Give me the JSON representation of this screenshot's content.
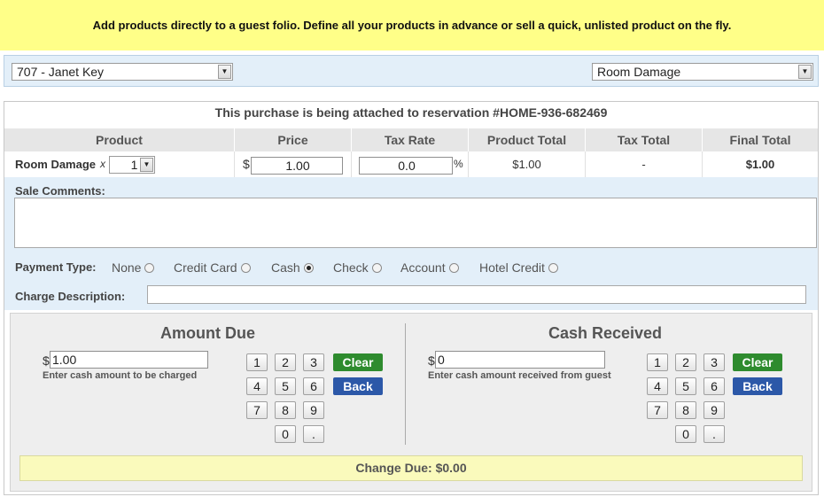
{
  "banner": "Add products directly to a guest folio. Define all your products in advance or sell a quick, unlisted product on the fly.",
  "guest_select": {
    "value": "707 - Janet Key"
  },
  "product_select": {
    "value": "Room Damage"
  },
  "reservation_text": "This purchase is being attached to reservation #HOME-936-682469",
  "table": {
    "headers": [
      "Product",
      "Price",
      "Tax Rate",
      "Product Total",
      "Tax Total",
      "Final Total"
    ],
    "row": {
      "product": "Room Damage",
      "qty_x": "x",
      "qty": "1",
      "currency": "$",
      "price": "1.00",
      "tax_rate": "0.0",
      "percent": "%",
      "product_total": "$1.00",
      "tax_total": "-",
      "final_total": "$1.00"
    }
  },
  "comments_label": "Sale Comments:",
  "payment": {
    "label": "Payment Type:",
    "options": [
      "None",
      "Credit Card",
      "Cash",
      "Check",
      "Account",
      "Hotel Credit"
    ],
    "selected": "Cash"
  },
  "charge_label": "Charge Description:",
  "amount_due": {
    "title": "Amount Due",
    "currency": "$",
    "value": "1.00",
    "hint": "Enter cash amount to be charged"
  },
  "cash_received": {
    "title": "Cash Received",
    "currency": "$",
    "value": "0",
    "hint": "Enter cash amount received from guest"
  },
  "keypad": {
    "keys": [
      "1",
      "2",
      "3",
      "4",
      "5",
      "6",
      "7",
      "8",
      "9",
      "0",
      "."
    ],
    "clear": "Clear",
    "back": "Back"
  },
  "change_due": "Change Due: $0.00",
  "colors": {
    "banner": "#ffff88",
    "clear": "#2e8b2e",
    "back": "#2c58a8",
    "panel_blue": "#e3eff9"
  }
}
